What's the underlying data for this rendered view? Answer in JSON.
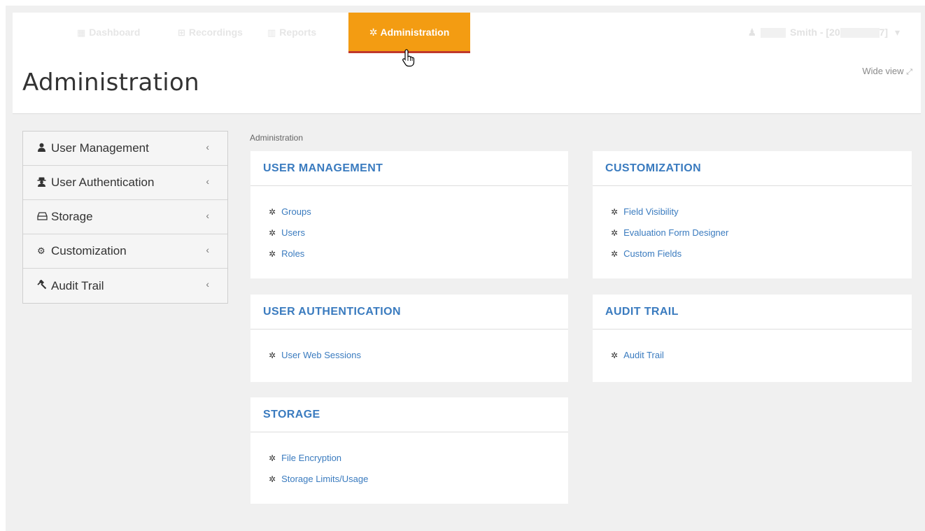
{
  "nav": {
    "items": [
      {
        "label": "Dashboard",
        "icon": "dashboard-icon"
      },
      {
        "label": "Recordings",
        "icon": "recordings-icon"
      },
      {
        "label": "Reports",
        "icon": "chart-icon"
      }
    ],
    "active": {
      "label": "Administration",
      "icon": "gear-icon",
      "color": "#f39c12"
    },
    "user": {
      "name_part": "Smith - [20",
      "suffix": "7]",
      "caret": "▾"
    }
  },
  "header": {
    "title": "Administration",
    "wide_view": "Wide view"
  },
  "sidebar": {
    "items": [
      {
        "label": "User Management",
        "icon": "user-icon"
      },
      {
        "label": "User Authentication",
        "icon": "user-secret-icon"
      },
      {
        "label": "Storage",
        "icon": "drive-icon"
      },
      {
        "label": "Customization",
        "icon": "gears-icon"
      },
      {
        "label": "Audit Trail",
        "icon": "gavel-icon"
      }
    ]
  },
  "breadcrumb": "Administration",
  "panels": {
    "user_management": {
      "title": "USER MANAGEMENT",
      "links": [
        "Groups",
        "Users",
        "Roles"
      ]
    },
    "customization": {
      "title": "CUSTOMIZATION",
      "links": [
        "Field Visibility",
        "Evaluation Form Designer",
        "Custom Fields"
      ]
    },
    "user_authentication": {
      "title": "USER AUTHENTICATION",
      "links": [
        "User Web Sessions"
      ]
    },
    "audit_trail": {
      "title": "AUDIT TRAIL",
      "links": [
        "Audit Trail"
      ]
    },
    "storage": {
      "title": "STORAGE",
      "links": [
        "File Encryption",
        "Storage Limits/Usage"
      ]
    }
  },
  "colors": {
    "link": "#3a7bbf",
    "accent": "#f39c12",
    "accent_border": "#c0392b"
  }
}
